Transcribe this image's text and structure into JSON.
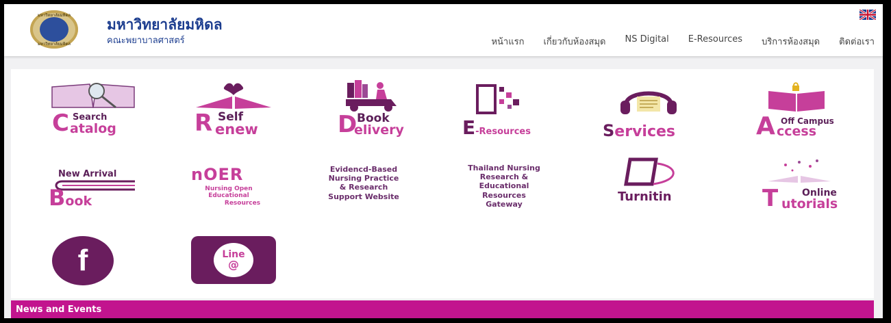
{
  "header": {
    "logo_text_top": "มหาวิทยาลัยมหิดล",
    "logo_text_bottom": "มหาวิทยาลัยมหิดล",
    "university": "มหาวิทยาลัยมหิดล",
    "faculty": "คณะพยาบาลศาสตร์",
    "flag_icon": "uk-flag-icon"
  },
  "nav": {
    "items": [
      "หน้าแรก",
      "เกี่ยวกับห้องสมุด",
      "NS Digital",
      "E-Resources",
      "บริการห้องสมุด",
      "ติดต่อเรา"
    ]
  },
  "tiles": {
    "search_catalog": {
      "letter": "C",
      "word1": "Search",
      "word2": "atalog"
    },
    "self_renew": {
      "letter": "R",
      "word1": "Self",
      "word2": "enew"
    },
    "book_delivery": {
      "letter": "D",
      "word1": "Book",
      "word2": "elivery"
    },
    "e_resources": {
      "letter": "E",
      "word2": "-Resources"
    },
    "services": {
      "letter": "S",
      "word2": "ervices"
    },
    "off_campus": {
      "letter": "A",
      "word1": "Off Campus",
      "word2": "ccess"
    },
    "new_arrival": {
      "letter": "B",
      "word1": "New Arrival",
      "word2": "ook"
    },
    "noer": {
      "title": "nOER",
      "line1": "Nursing Open",
      "line2": "Educational",
      "line3": "Resources"
    },
    "ebp": {
      "line1": "Evidencd-Based",
      "line2": "Nursing Practice",
      "line3": "& Research",
      "line4": "Support Website"
    },
    "thailand": {
      "line1": "Thailand Nursing",
      "line2": "Research &",
      "line3": "Educational",
      "line4": "Resources",
      "line5": "Gateway"
    },
    "turnitin": {
      "label": "Turnitin"
    },
    "tutorials": {
      "letter": "T",
      "word1": "Online",
      "word2": "utorials"
    },
    "facebook": {
      "glyph": "f"
    },
    "line": {
      "word": "Line",
      "at": "@"
    }
  },
  "news": {
    "title": "News and Events"
  },
  "colors": {
    "accent": "#c2148e",
    "purple": "#5b1f58",
    "pink": "#c63f9a",
    "brand_blue": "#1c3d8f"
  }
}
